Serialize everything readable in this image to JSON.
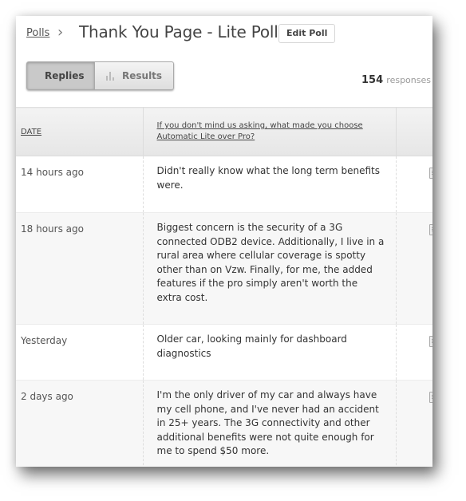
{
  "breadcrumb": {
    "parent": "Polls",
    "separator": "›"
  },
  "header": {
    "title": "Thank You Page - Lite Poll",
    "edit_button": "Edit Poll"
  },
  "view_toggle": {
    "replies_label": "Replies",
    "results_label": "Results",
    "active": "Replies"
  },
  "responses": {
    "count": "154",
    "label": "responses"
  },
  "table": {
    "columns": [
      "DATE",
      "If you don't mind us asking, what made you choose Automatic Lite over Pro?",
      ""
    ],
    "rows": [
      {
        "date": "14 hours ago",
        "reply": "Didn't really know what the long term benefits were."
      },
      {
        "date": "18 hours ago",
        "reply": "Biggest concern is the security of a 3G connected ODB2 device. Additionally, I live in a rural area where cellular coverage is spotty other than on Vzw. Finally, for me, the added features if the pro simply aren't worth the extra cost."
      },
      {
        "date": "Yesterday",
        "reply": "Older car, looking mainly for dashboard diagnostics"
      },
      {
        "date": "2 days ago",
        "reply": "I'm the only driver of my car and always have my cell phone, and I've never had an accident in 25+ years. The 3G connectivity and other additional benefits were not quite enough for me to spend $50 more."
      }
    ]
  }
}
